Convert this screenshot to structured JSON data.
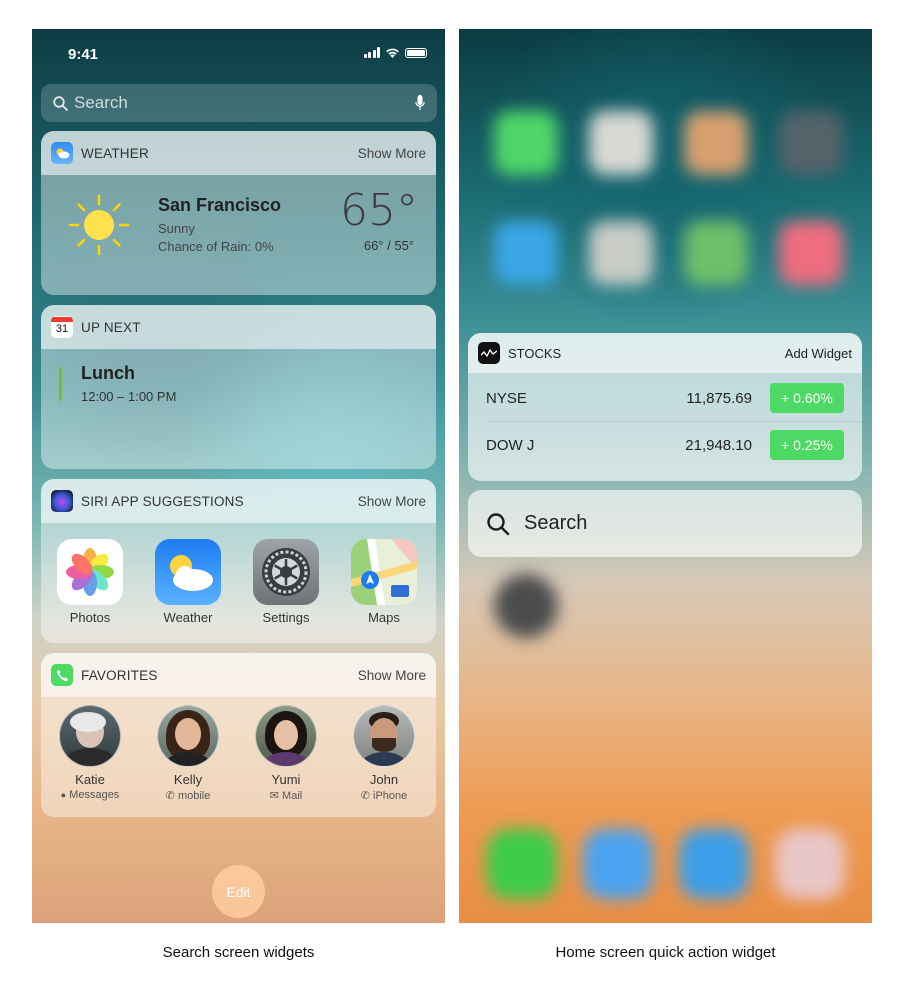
{
  "left_panel": {
    "status": {
      "time": "9:41"
    },
    "search": {
      "placeholder": "Search"
    },
    "weather": {
      "title": "WEATHER",
      "action": "Show More",
      "city": "San Francisco",
      "condition": "Sunny",
      "rain": "Chance of Rain: 0%",
      "temp": "65°",
      "hilo": "66° / 55°"
    },
    "up_next": {
      "title": "UP NEXT",
      "calendar_day": "31",
      "event": "Lunch",
      "time": "12:00 – 1:00 PM"
    },
    "siri": {
      "title": "SIRI APP SUGGESTIONS",
      "action": "Show More",
      "apps": [
        {
          "label": "Photos",
          "icon": "photos-icon"
        },
        {
          "label": "Weather",
          "icon": "weather-app-icon"
        },
        {
          "label": "Settings",
          "icon": "settings-icon"
        },
        {
          "label": "Maps",
          "icon": "maps-icon"
        }
      ]
    },
    "favorites": {
      "title": "FAVORITES",
      "action": "Show More",
      "contacts": [
        {
          "name": "Katie",
          "via": "Messages",
          "via_icon": "message-icon"
        },
        {
          "name": "Kelly",
          "via": "mobile",
          "via_icon": "phone-icon"
        },
        {
          "name": "Yumi",
          "via": "Mail",
          "via_icon": "mail-icon"
        },
        {
          "name": "John",
          "via": "iPhone",
          "via_icon": "phone-icon"
        }
      ]
    },
    "edit_label": "Edit",
    "caption": "Search screen widgets"
  },
  "right_panel": {
    "stocks": {
      "title": "STOCKS",
      "action": "Add Widget",
      "rows": [
        {
          "symbol": "NYSE",
          "value": "11,875.69",
          "change": "+ 0.60%"
        },
        {
          "symbol": "DOW J",
          "value": "21,948.10",
          "change": "+ 0.25%"
        }
      ]
    },
    "search_label": "Search",
    "caption": "Home screen quick action widget"
  },
  "colors": {
    "positive": "#4cd964",
    "event_accent": "#7dbb2b"
  }
}
